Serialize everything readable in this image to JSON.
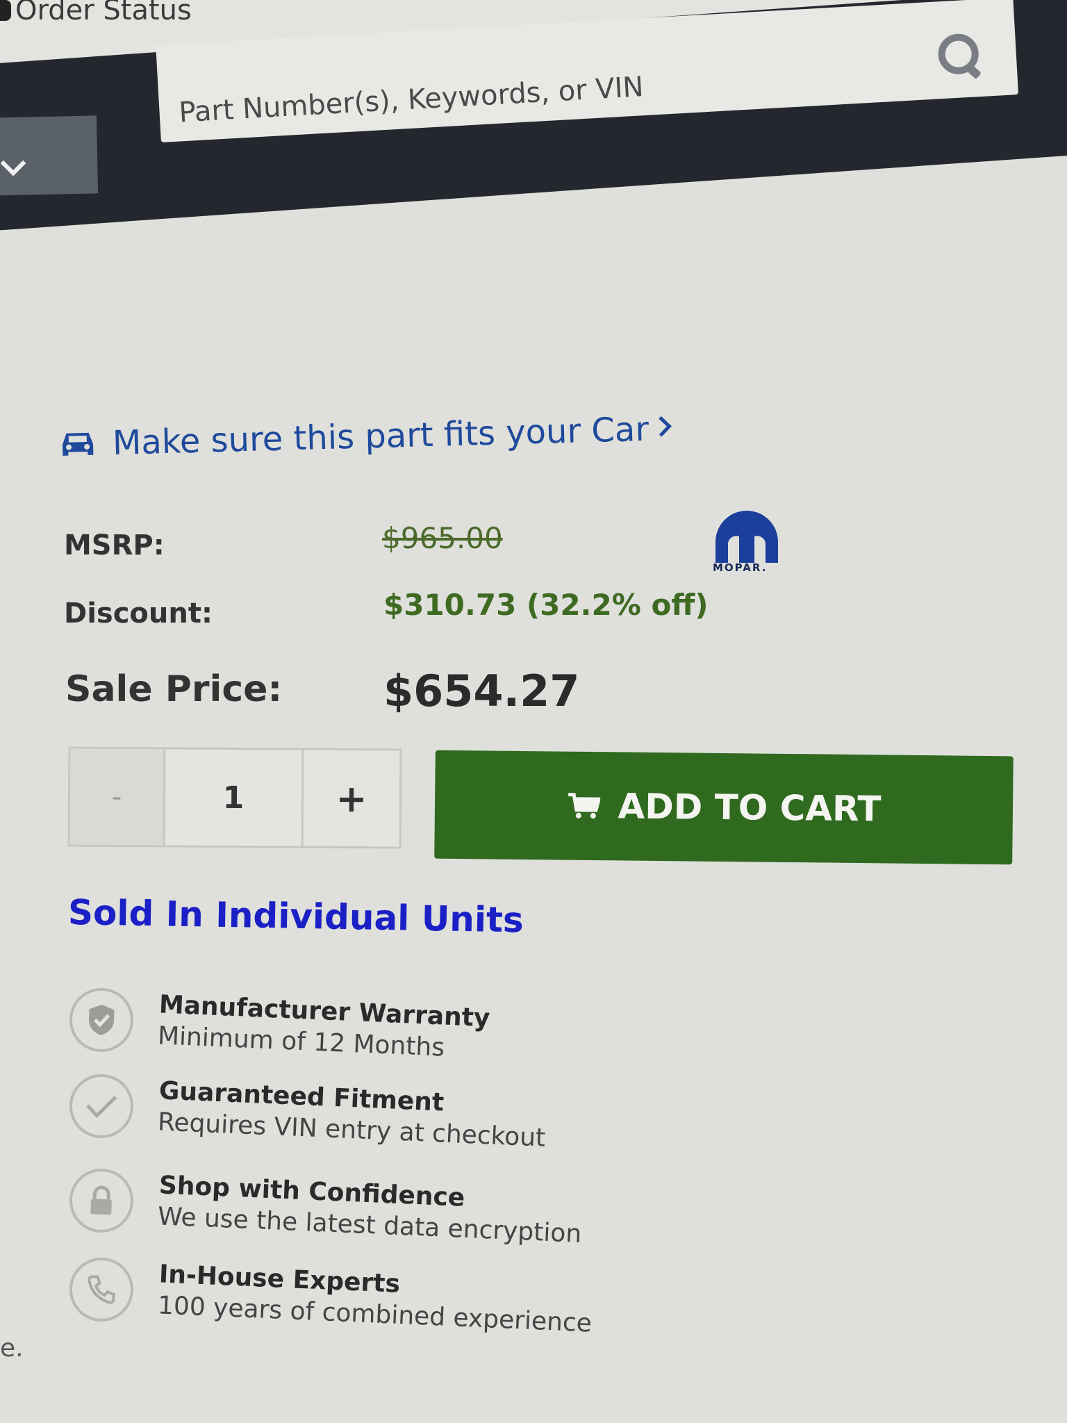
{
  "header": {
    "order_status": "Order Status",
    "search_placeholder": "Part Number(s), Keywords, or VIN"
  },
  "fitment": {
    "link_text": "Make sure this part fits your Car"
  },
  "pricing": {
    "msrp_label": "MSRP:",
    "msrp_value": "$965.00",
    "discount_label": "Discount:",
    "discount_value": "$310.73 (32.2% off)",
    "sale_label": "Sale Price:",
    "sale_value": "$654.27"
  },
  "brand": {
    "name": "MOPAR."
  },
  "cart": {
    "minus_label": "-",
    "quantity": "1",
    "plus_label": "+",
    "add_to_cart_label": "ADD TO CART"
  },
  "sold_in_units": "Sold In Individual Units",
  "features": [
    {
      "title": "Manufacturer Warranty",
      "subtitle": "Minimum of 12 Months",
      "icon": "shield-check-icon"
    },
    {
      "title": "Guaranteed Fitment",
      "subtitle": "Requires VIN entry at checkout",
      "icon": "checkmark-icon"
    },
    {
      "title": "Shop with Confidence",
      "subtitle": "We use the latest data encryption",
      "icon": "lock-icon"
    },
    {
      "title": "In-House Experts",
      "subtitle": "100 years of combined experience",
      "icon": "phone-icon"
    }
  ],
  "edge_text": "e.",
  "colors": {
    "link_blue": "#1f4a9c",
    "sold_units_blue": "#1b20c6",
    "discount_green": "#3e6a21",
    "cart_green": "#2f6a1f",
    "nav_dark": "#24282e"
  }
}
